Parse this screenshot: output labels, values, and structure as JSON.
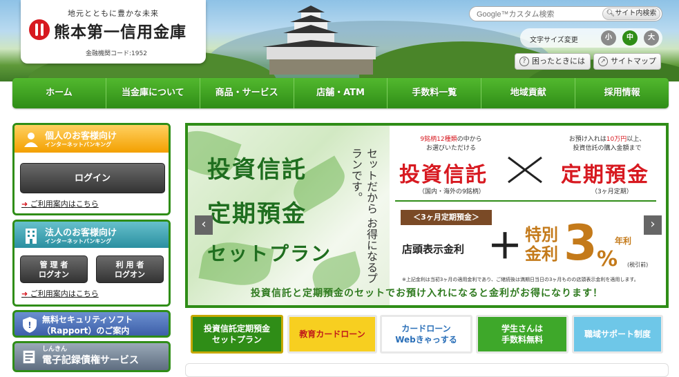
{
  "header": {
    "tagline": "地元とともに豊かな未来",
    "bank_name": "熊本第一信用金庫",
    "bank_code": "金融機関コード:1952",
    "search_placeholder": "Google™カスタム検索",
    "search_button": "サイト内検索",
    "font_size_label": "文字サイズ変更",
    "font_sizes": [
      "小",
      "中",
      "大"
    ],
    "help_label": "困ったときには",
    "sitemap_label": "サイトマップ"
  },
  "nav": [
    "ホーム",
    "当金庫について",
    "商品・サービス",
    "店舗・ATM",
    "手数料一覧",
    "地域貢献",
    "採用情報"
  ],
  "sidebar": {
    "personal_title": "個人のお客様向け",
    "personal_sub": "インターネットバンキング",
    "login_label": "ログイン",
    "guide_link": "ご利用案内はこちら",
    "corp_title": "法人のお客様向け",
    "corp_sub": "インターネットバンキング",
    "admin_login": [
      "管 理 者",
      "ログオン"
    ],
    "user_login": [
      "利 用 者",
      "ログオン"
    ],
    "corp_guide_link": "ご利用案内はこちら",
    "security_banner": [
      "無料セキュリティソフト",
      "（Rapport）のご案内"
    ],
    "erecord_small": "しんきん",
    "erecord_banner": "電子記録債権サービス"
  },
  "banner": {
    "left_lines": [
      "投資信託",
      "定期預金",
      "セットプラン"
    ],
    "vertical_text": "セットだから お得になるプランです。",
    "note_left_a": "9銘柄12種類",
    "note_left_b": "の中から",
    "note_left_c": "お選びいただける",
    "note_right_a": "お預け入れは",
    "note_right_b": "10万円",
    "note_right_c": "以上、",
    "note_right_d": "投資信託の購入金額まで",
    "big_left": "投資信託",
    "big_right": "定期預金",
    "small_left": "（国内・海外の9銘柄）",
    "small_right": "（3ヶ月定期）",
    "tag": "＜3ヶ月定期預金＞",
    "store_rate": "店頭表示金利",
    "plus": "＋",
    "special": [
      "特別",
      "金利"
    ],
    "rate_number": "3",
    "rate_pct": "%",
    "rate_label": "年利",
    "tax_note": "(税引前)",
    "footnote": "※上記金利は当初3ヶ月の適用金利であり、ご継続後は満期日当日の3ヶ月ものの店頭表示金利を適用します。",
    "caption": "投資信託と定期預金のセットでお預け入れになると金利がお得になります！",
    "prev_arrow": "‹",
    "next_arrow": "›"
  },
  "subtabs": [
    [
      "投資信託定期預金",
      "セットプラン"
    ],
    [
      "教育カードローン"
    ],
    [
      "カードローン",
      "Webきゃっする"
    ],
    [
      "学生さんは",
      "手数料無料"
    ],
    [
      "職域サポート制度"
    ]
  ],
  "colors": {
    "brand_green": "#2f8d17",
    "brand_red": "#d71920",
    "accent_orange": "#f3a000",
    "accent_teal": "#2a8fa0"
  }
}
